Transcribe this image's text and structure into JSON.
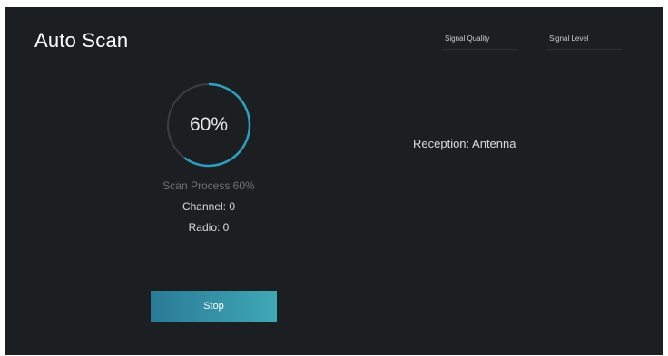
{
  "header": {
    "title": "Auto Scan",
    "signal_quality_label": "Signal Quality",
    "signal_level_label": "Signal Level"
  },
  "scan": {
    "progress_percent": 60,
    "progress_text": "60%",
    "process_text": "Scan Process 60%",
    "channel_text": "Channel: 0",
    "radio_text": "Radio: 0"
  },
  "reception": {
    "text": "Reception: Antenna"
  },
  "actions": {
    "stop_label": "Stop"
  },
  "colors": {
    "background": "#1c1f22",
    "ring_track": "#3a3f45",
    "ring_progress": "#2e9fc0",
    "button_start": "#2a7a96",
    "button_end": "#3fa8b5"
  },
  "icons": {
    "progress": "progress-ring-icon"
  }
}
